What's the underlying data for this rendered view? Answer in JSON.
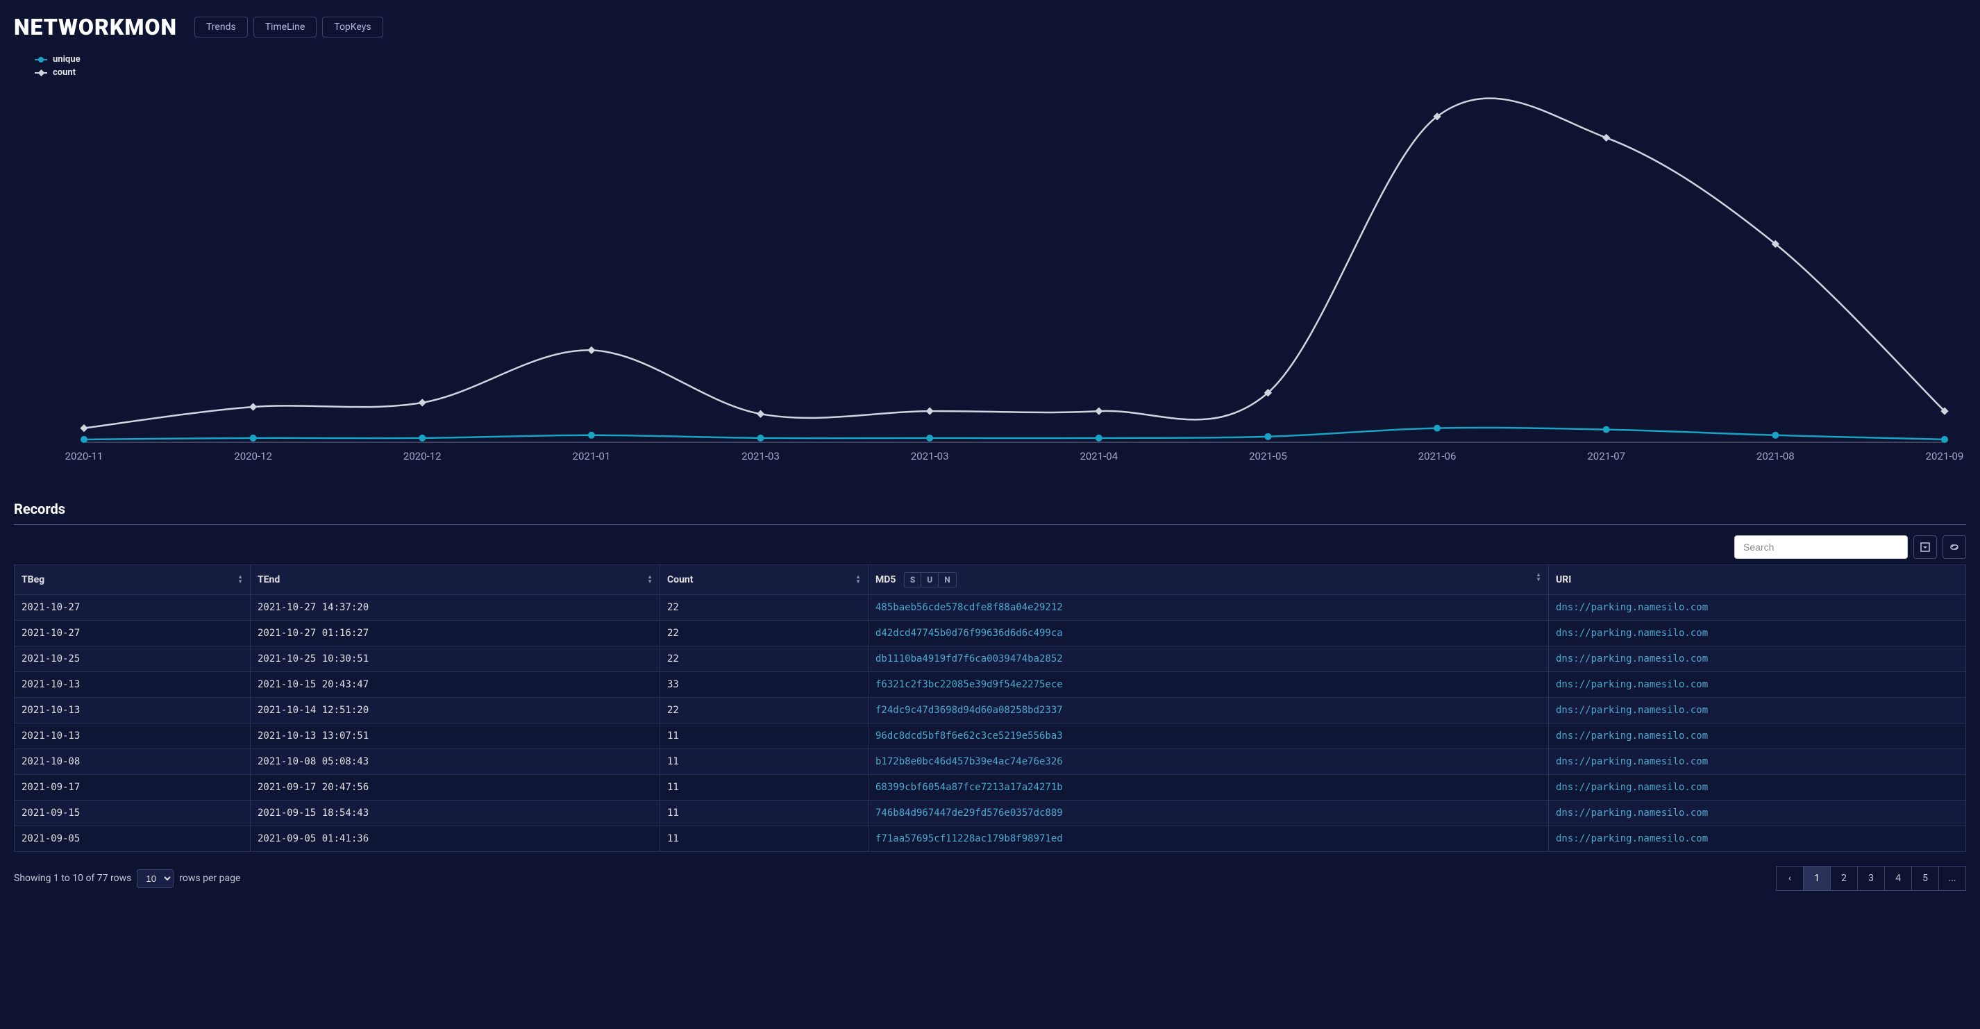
{
  "brand": "NETWORKMON",
  "nav": {
    "trends": "Trends",
    "timeline": "TimeLine",
    "topkeys": "TopKeys"
  },
  "chart_data": {
    "type": "line",
    "title": "",
    "xlabel": "",
    "ylabel": "",
    "categories": [
      "2020-11",
      "2020-12",
      "2020-12",
      "2021-01",
      "2021-03",
      "2021-03",
      "2021-04",
      "2021-05",
      "2021-06",
      "2021-07",
      "2021-08",
      "2021-09"
    ],
    "series": [
      {
        "name": "unique",
        "color": "#19a3c4",
        "marker": "circle",
        "values": [
          2,
          3,
          3,
          5,
          3,
          3,
          3,
          4,
          10,
          9,
          5,
          2
        ]
      },
      {
        "name": "count",
        "color": "#d0d6e0",
        "marker": "diamond",
        "values": [
          10,
          25,
          28,
          65,
          20,
          22,
          22,
          35,
          230,
          215,
          140,
          22
        ]
      }
    ],
    "ylim": [
      0,
      250
    ]
  },
  "legend": {
    "unique": "unique",
    "count": "count"
  },
  "records": {
    "title": "Records",
    "search_placeholder": "Search",
    "columns": {
      "tbeg": "TBeg",
      "tend": "TEnd",
      "count": "Count",
      "md5": "MD5",
      "uri": "URI"
    },
    "md5_controls": {
      "s": "S",
      "u": "U",
      "n": "N"
    },
    "rows": [
      {
        "tbeg": "2021-10-27",
        "tend": "2021-10-27 14:37:20",
        "count": "22",
        "md5": "485baeb56cde578cdfe8f88a04e29212",
        "uri": "dns://parking.namesilo.com"
      },
      {
        "tbeg": "2021-10-27",
        "tend": "2021-10-27 01:16:27",
        "count": "22",
        "md5": "d42dcd47745b0d76f99636d6d6c499ca",
        "uri": "dns://parking.namesilo.com"
      },
      {
        "tbeg": "2021-10-25",
        "tend": "2021-10-25 10:30:51",
        "count": "22",
        "md5": "db1110ba4919fd7f6ca0039474ba2852",
        "uri": "dns://parking.namesilo.com"
      },
      {
        "tbeg": "2021-10-13",
        "tend": "2021-10-15 20:43:47",
        "count": "33",
        "md5": "f6321c2f3bc22085e39d9f54e2275ece",
        "uri": "dns://parking.namesilo.com"
      },
      {
        "tbeg": "2021-10-13",
        "tend": "2021-10-14 12:51:20",
        "count": "22",
        "md5": "f24dc9c47d3698d94d60a08258bd2337",
        "uri": "dns://parking.namesilo.com"
      },
      {
        "tbeg": "2021-10-13",
        "tend": "2021-10-13 13:07:51",
        "count": "11",
        "md5": "96dc8dcd5bf8f6e62c3ce5219e556ba3",
        "uri": "dns://parking.namesilo.com"
      },
      {
        "tbeg": "2021-10-08",
        "tend": "2021-10-08 05:08:43",
        "count": "11",
        "md5": "b172b8e0bc46d457b39e4ac74e76e326",
        "uri": "dns://parking.namesilo.com"
      },
      {
        "tbeg": "2021-09-17",
        "tend": "2021-09-17 20:47:56",
        "count": "11",
        "md5": "68399cbf6054a87fce7213a17a24271b",
        "uri": "dns://parking.namesilo.com"
      },
      {
        "tbeg": "2021-09-15",
        "tend": "2021-09-15 18:54:43",
        "count": "11",
        "md5": "746b84d967447de29fd576e0357dc889",
        "uri": "dns://parking.namesilo.com"
      },
      {
        "tbeg": "2021-09-05",
        "tend": "2021-09-05 01:41:36",
        "count": "11",
        "md5": "f71aa57695cf11228ac179b8f98971ed",
        "uri": "dns://parking.namesilo.com"
      }
    ]
  },
  "footer": {
    "showing_text": "Showing 1 to 10 of 77 rows",
    "page_size": "10",
    "per_page_label": "rows per page",
    "pages": [
      "1",
      "2",
      "3",
      "4",
      "5"
    ],
    "prev": "‹",
    "more": "..."
  }
}
